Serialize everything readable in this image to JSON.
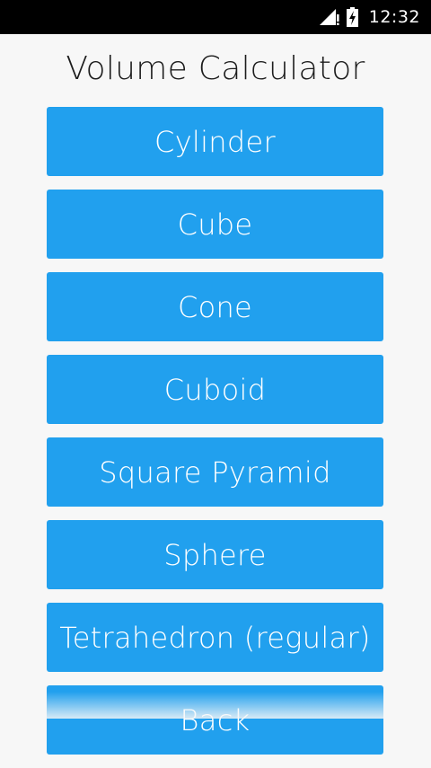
{
  "status_bar": {
    "time": "12:32",
    "signal_icon": "signal-icon",
    "battery_icon": "battery-charging-icon"
  },
  "app": {
    "title": "Volume Calculator"
  },
  "buttons": [
    {
      "label": "Cylinder"
    },
    {
      "label": "Cube"
    },
    {
      "label": "Cone"
    },
    {
      "label": "Cuboid"
    },
    {
      "label": "Square Pyramid"
    },
    {
      "label": "Sphere"
    },
    {
      "label": "Tetrahedron (regular)"
    },
    {
      "label": "Back"
    }
  ],
  "colors": {
    "button_background": "#21a0ee",
    "button_text": "#ffffff",
    "page_background": "#f7f7f7",
    "status_bar": "#000000"
  }
}
